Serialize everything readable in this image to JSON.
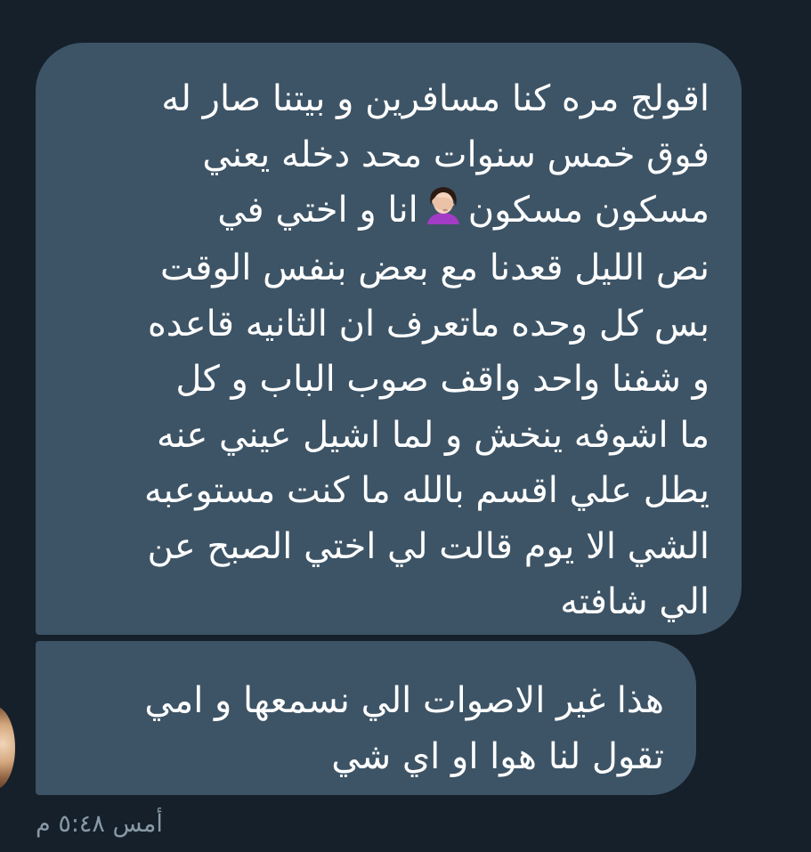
{
  "conversation": {
    "messages": [
      {
        "lines": [
          "اقولج مره كنا مسافرين و بيتنا صار له",
          "فوق خمس سنوات محد دخله يعني",
          "مسكون مسكون",
          "انا و اختي في",
          "نص الليل قعدنا مع بعض بنفس الوقت",
          "بس كل وحده ماتعرف ان الثانيه قاعده",
          "و شفنا  واحد واقف صوب الباب و كل",
          "ما اشوفه ينخش و لما اشيل عيني عنه",
          "يطل علي اقسم بالله ما كنت مستوعبه",
          "الشي الا يوم قالت لي اختي الصبح عن",
          "الي شافته"
        ],
        "emoji": "facepalm-icon"
      },
      {
        "lines": [
          "هذا غير الاصوات الي نسمعها و امي",
          "تقول لنا هوا او اي شي"
        ]
      }
    ],
    "timestamp": "أمس ٥:٤٨ م"
  },
  "colors": {
    "background": "#15202b",
    "bubble": "#3d5466",
    "text": "#ffffff",
    "timestamp": "#8899a6"
  }
}
